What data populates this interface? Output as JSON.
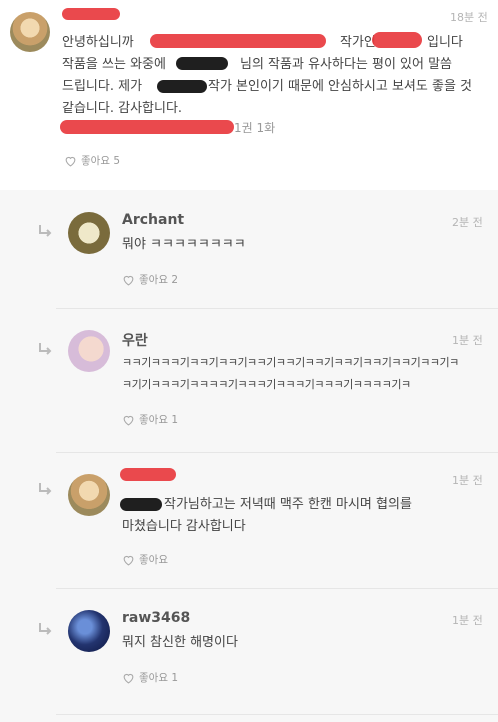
{
  "post": {
    "time": "18분 전",
    "line1": "안녕하십니까",
    "line1_mid": "작가인",
    "line1_end": "입니다",
    "line2_a": "작품을 쓰는 와중에",
    "line2_b": "님의 작품과 유사하다는 평이 있어 말씀",
    "line3_a": "드립니다. 제가",
    "line3_b": "작가 본인이기 때문에 안심하시고 보셔도 좋을 것",
    "line4": "같습니다. 감사합니다.",
    "ref_tail": "1권 1화",
    "like_label": "좋아요 5"
  },
  "replies": [
    {
      "name": "Archant",
      "time": "2분 전",
      "text": "뭐야 ㅋㅋㅋㅋㅋㅋㅋㅋ",
      "like_label": "좋아요 2"
    },
    {
      "name": "우란",
      "time": "1분 전",
      "text1": "ㅋㅋ기ㅋㅋㅋ기ㅋㅋ기ㅋㅋ기ㅋㅋ기ㅋㅋ기ㅋㅋ기ㅋㅋ기ㅋㅋ기ㅋㅋ기ㅋㅋ기ㅋ",
      "text2": "ㅋ기기ㅋㅋㅋ기ㅋㅋㅋㅋ기ㅋㅋㅋ기ㅋㅋㅋ기ㅋㅋㅋ기ㅋㅋㅋㅋ기ㅋ",
      "like_label": "좋아요 1"
    },
    {
      "time": "1분 전",
      "text1_tail": "작가님하고는 저녁때 맥주 한캔 마시며 협의를",
      "text2": "마쳤습니다 감사합니다",
      "like_label": "좋아요"
    },
    {
      "name": "raw3468",
      "time": "1분 전",
      "text": "뭐지 참신한 해명이다",
      "like_label": "좋아요 1"
    }
  ],
  "icons": {
    "like": "heart-outline-icon",
    "reply": "reply-arrow-icon"
  },
  "colors": {
    "redact": "#e8393e",
    "meta": "#b5b5b5",
    "background": "#f7f7f7"
  }
}
